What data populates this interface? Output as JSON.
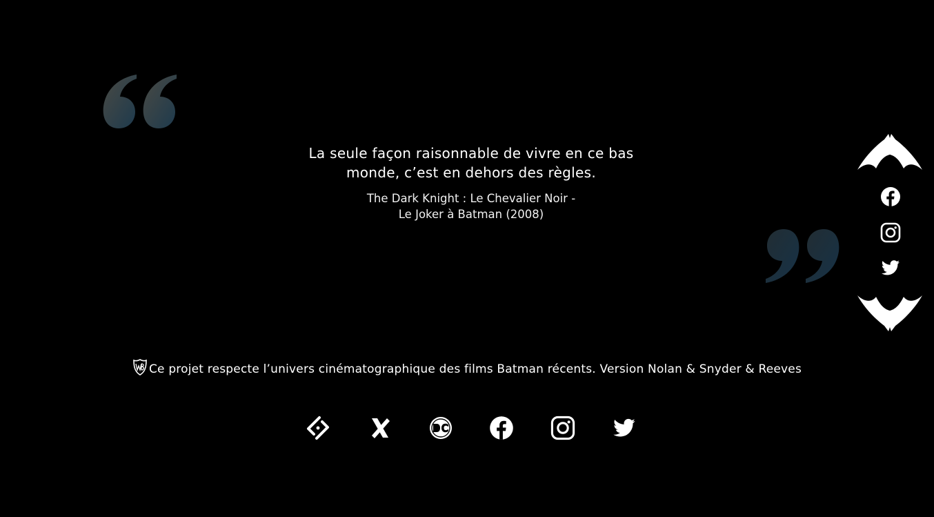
{
  "quote": {
    "text": "La seule façon raisonnable de vivre en ce bas monde, c’est en dehors des règles.",
    "source_line1": "The Dark Knight : Le Chevalier Noir -",
    "source_line2": "Le Joker à Batman (2008)"
  },
  "quote_marks": {
    "open_icon": "quote-open-icon",
    "close_icon": "quote-close-icon",
    "open_gradient": [
      "#4a4a44",
      "#1d3a4d"
    ],
    "close_gradient": [
      "#1d3a4d",
      "#142a38"
    ]
  },
  "side_nav": {
    "items": [
      {
        "icon": "facebook-icon"
      },
      {
        "icon": "instagram-icon"
      },
      {
        "icon": "twitter-icon"
      }
    ],
    "top_icon": "bat-wing-top-icon",
    "bottom_icon": "bat-wing-bottom-icon"
  },
  "notice": {
    "logo_icon": "warner-bros-shield-icon",
    "text": "Ce projet respecte l’univers cinématographique des films Batman récents. Version Nolan & Snyder & Reeves"
  },
  "footer_links": [
    {
      "icon": "letterboxd-code-icon"
    },
    {
      "icon": "x-cross-icon"
    },
    {
      "icon": "dc-logo-icon"
    },
    {
      "icon": "facebook-icon"
    },
    {
      "icon": "instagram-icon"
    },
    {
      "icon": "twitter-icon"
    }
  ],
  "colors": {
    "background": "#000000",
    "text": "#ffffff"
  }
}
